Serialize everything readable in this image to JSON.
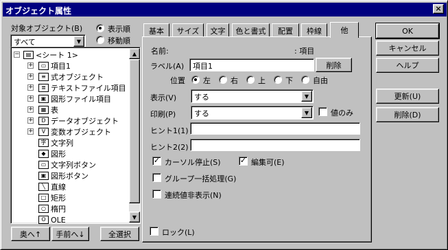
{
  "window": {
    "title": "オブジェクト属性",
    "close": "×"
  },
  "left": {
    "target_label": "対象オブジェクト(B)",
    "sort_display": "表示順",
    "sort_move": "移動順",
    "filter_value": "すべて",
    "tree": [
      {
        "label": "<シート 1>",
        "icon": "sheet-icon",
        "level": 0,
        "expander": "−"
      },
      {
        "label": "項目1",
        "icon": "field-icon",
        "level": 1,
        "expander": "+"
      },
      {
        "label": "式オブジェクト",
        "icon": "formula-icon",
        "level": 1,
        "expander": "+"
      },
      {
        "label": "テキストファイル項目",
        "icon": "textfile-icon",
        "level": 1,
        "expander": "+"
      },
      {
        "label": "図形ファイル項目",
        "icon": "imagefile-icon",
        "level": 1,
        "expander": "+"
      },
      {
        "label": "表",
        "icon": "table-icon",
        "level": 1,
        "expander": "+"
      },
      {
        "label": "データオブジェクト",
        "icon": "data-icon",
        "level": 1,
        "expander": "+"
      },
      {
        "label": "変数オブジェクト",
        "icon": "variable-icon",
        "level": 1,
        "expander": "+"
      },
      {
        "label": "文字列",
        "icon": "string-icon",
        "level": 1,
        "expander": ""
      },
      {
        "label": "図形",
        "icon": "shape-icon",
        "level": 1,
        "expander": ""
      },
      {
        "label": "文字列ボタン",
        "icon": "string-button-icon",
        "level": 1,
        "expander": ""
      },
      {
        "label": "図形ボタン",
        "icon": "shape-button-icon",
        "level": 1,
        "expander": ""
      },
      {
        "label": "直線",
        "icon": "line-icon",
        "level": 1,
        "expander": ""
      },
      {
        "label": "矩形",
        "icon": "rect-icon",
        "level": 1,
        "expander": ""
      },
      {
        "label": "楕円",
        "icon": "ellipse-icon",
        "level": 1,
        "expander": ""
      },
      {
        "label": "OLE",
        "icon": "ole-icon",
        "level": 1,
        "expander": ""
      }
    ],
    "btn_back": "奥へ↑",
    "btn_front": "手前へ↓",
    "btn_select_all": "全選択"
  },
  "tabs": [
    "基本",
    "サイズ",
    "文字",
    "色と書式",
    "配置",
    "枠線",
    "他"
  ],
  "active_tab": "他",
  "props": {
    "name_label": "名前:",
    "name_value": ": 項目",
    "label_label": "ラベル(A)",
    "label_value": "項目1",
    "delete_btn": "削除",
    "position_label": "位置",
    "positions": [
      "左",
      "右",
      "上",
      "下",
      "自由"
    ],
    "display_label": "表示(V)",
    "display_value": "する",
    "print_label": "印刷(P)",
    "print_value": "する",
    "value_only": "値のみ",
    "hint1_label": "ヒント1(1)",
    "hint2_label": "ヒント2(2)",
    "cursor_stop": "カーソル停止(S)",
    "editable": "編集可(E)",
    "group_process": "グループ一括処理(G)",
    "hide_continuous": "連続値非表示(N)",
    "lock": "ロック(L)"
  },
  "right": {
    "ok": "OK",
    "cancel": "キャンセル",
    "help": "ヘルプ",
    "update": "更新(U)",
    "delete": "削除(D)"
  }
}
